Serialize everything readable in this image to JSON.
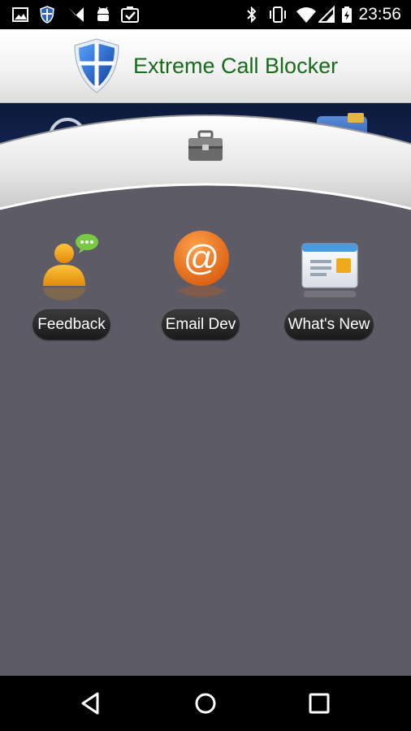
{
  "status_bar": {
    "time": "23:56",
    "left_icons": [
      "image-icon",
      "shield-notification-icon",
      "app-notification-icon",
      "android-icon",
      "checklist-icon"
    ],
    "right_icons": [
      "bluetooth-icon",
      "vibrate-icon",
      "wifi-icon",
      "cell-signal-icon",
      "battery-charging-icon"
    ]
  },
  "header": {
    "title": "Extreme Call Blocker"
  },
  "panel": {
    "icon": "toolbox-icon"
  },
  "tiles": [
    {
      "label": "Feedback",
      "icon": "feedback-user-chat-icon"
    },
    {
      "label": "Email Dev",
      "icon": "email-at-icon"
    },
    {
      "label": "What's New",
      "icon": "news-window-icon"
    }
  ],
  "nav_bar": {
    "buttons": [
      "back-icon",
      "home-icon",
      "recents-icon"
    ]
  },
  "colors": {
    "title_text": "#176b1b",
    "content_bg": "#5c5b66",
    "email_orange": "#e8731c",
    "feedback_yellow": "#f2a81c",
    "chat_green": "#7ac943"
  }
}
